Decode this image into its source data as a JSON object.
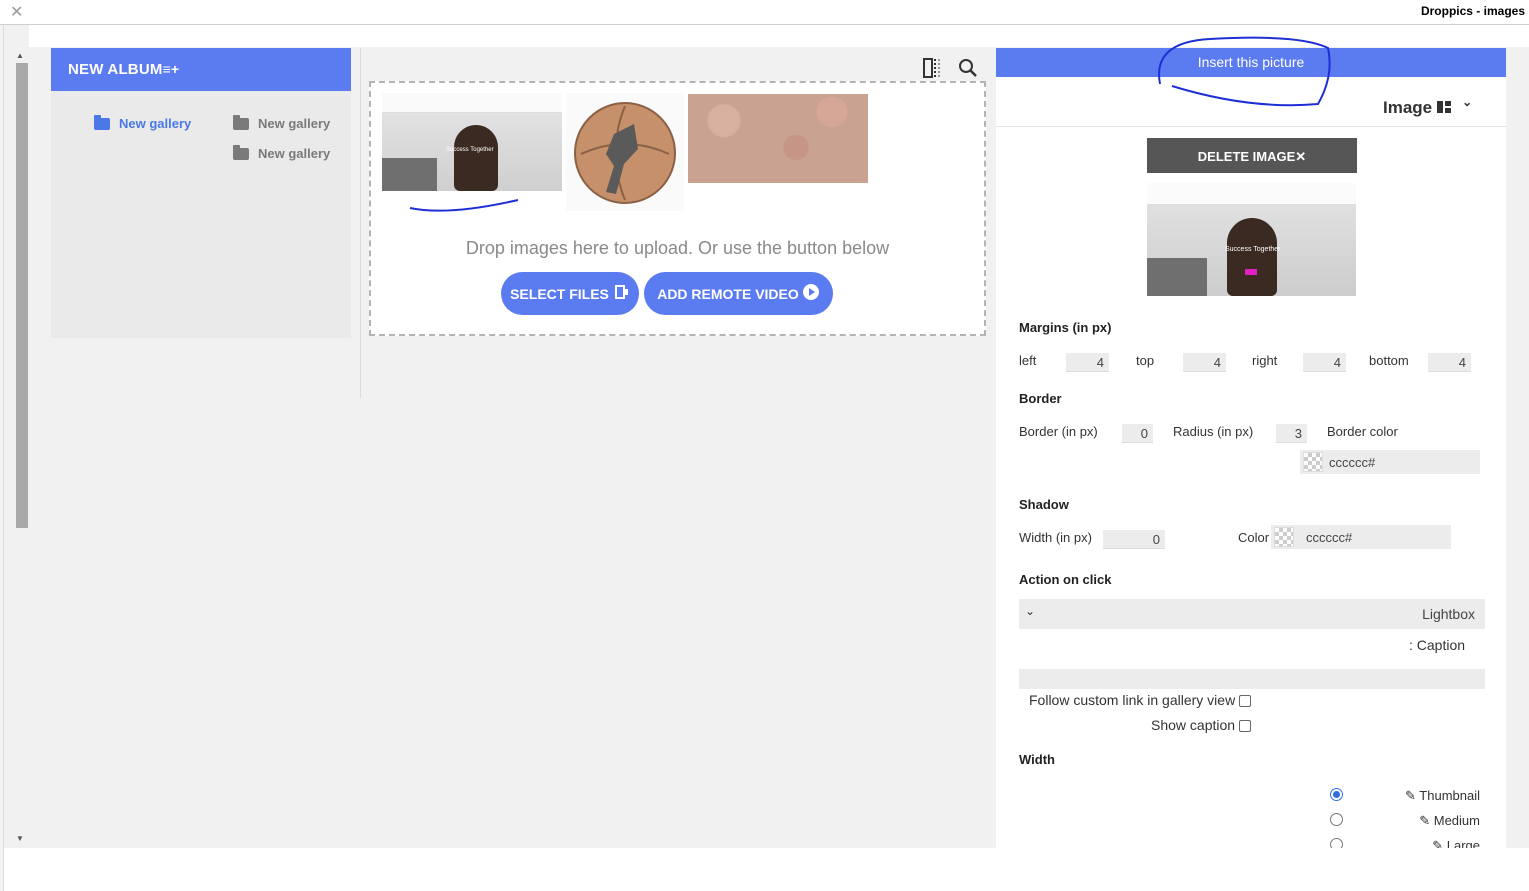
{
  "window": {
    "title": "Droppics - images",
    "close_glyph": "✕"
  },
  "albums": {
    "new_album_label": "NEW ALBUM",
    "galleries": [
      {
        "label": "New gallery",
        "active": true
      },
      {
        "label": "New gallery",
        "active": false
      },
      {
        "label": "New gallery",
        "active": false
      }
    ]
  },
  "toolbar": {
    "icons": [
      "split-view-icon",
      "search-icon"
    ]
  },
  "dropzone": {
    "instruction": "Drop images here to upload. Or use the button below",
    "select_files_label": "SELECT FILES",
    "add_video_label": "ADD REMOTE VIDEO",
    "thumb_text": "Success Together"
  },
  "right_panel": {
    "insert_button": "Insert this picture",
    "image_header": "Image",
    "delete_button": "DELETE IMAGE",
    "delete_glyph": "✕",
    "margins": {
      "title": "Margins (in px)",
      "left_label": "left",
      "left": "4",
      "top_label": "top",
      "top": "4",
      "right_label": "right",
      "right": "4",
      "bottom_label": "bottom",
      "bottom": "4"
    },
    "border": {
      "title": "Border",
      "width_label": "Border (in px)",
      "width": "0",
      "radius_label": "Radius (in px)",
      "radius": "3",
      "color_label": "Border color",
      "color": "cccccc#"
    },
    "shadow": {
      "title": "Shadow",
      "width_label": "Width (in px)",
      "width": "0",
      "color_label": "Color",
      "color": "cccccc#"
    },
    "action": {
      "title": "Action on click",
      "selected": "Lightbox",
      "caption_label": ": Caption",
      "follow_link_label": "Follow custom link in gallery view",
      "show_caption_label": "Show caption"
    },
    "width": {
      "title": "Width",
      "options": [
        {
          "label": "Thumbnail",
          "selected": true
        },
        {
          "label": "Medium",
          "selected": false
        },
        {
          "label": "Large",
          "selected": false
        }
      ]
    }
  },
  "colors": {
    "accent": "#5b7bf0",
    "annotation": "#1f2fd6",
    "delete_bg": "#565656"
  }
}
